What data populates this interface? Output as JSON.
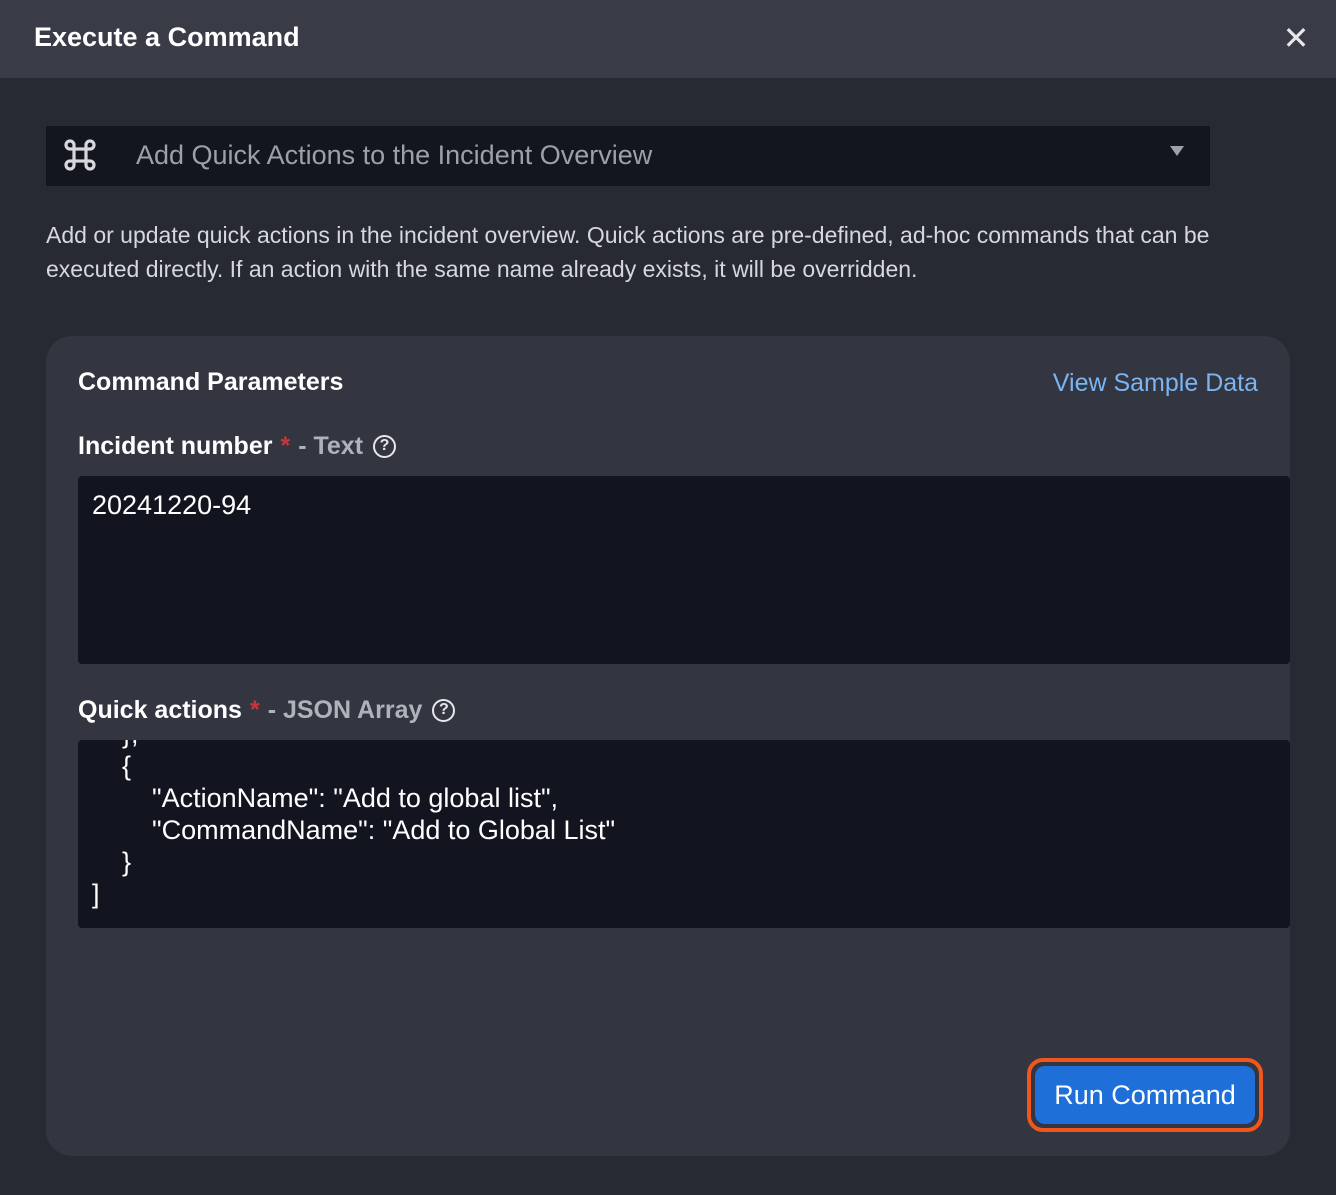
{
  "dialog": {
    "title": "Execute a Command",
    "close_icon": "close-icon"
  },
  "command_select": {
    "icon": "command-key-icon",
    "selected": "Add Quick Actions to the Incident Overview",
    "caret_icon": "chevron-down-icon"
  },
  "description": "Add or update quick actions in the incident overview. Quick actions are pre-defined, ad-hoc commands that can be executed directly. If an action with the same name already exists, it will be overridden.",
  "parameters": {
    "title": "Command Parameters",
    "sample_link": "View Sample Data",
    "fields": [
      {
        "label": "Incident number",
        "required_mark": "*",
        "type": "- Text",
        "help_icon": "?",
        "value": "20241220-94"
      },
      {
        "label": "Quick actions",
        "required_mark": "*",
        "type": "- JSON Array",
        "help_icon": "?",
        "value_lines": [
          "    },",
          "    {",
          "        \"ActionName\": \"Add to global list\",",
          "        \"CommandName\": \"Add to Global List\"",
          "    }",
          "]"
        ]
      }
    ]
  },
  "run_button": {
    "label": "Run Command",
    "accent": "#1f6fd9",
    "highlight": "#f0561e"
  }
}
